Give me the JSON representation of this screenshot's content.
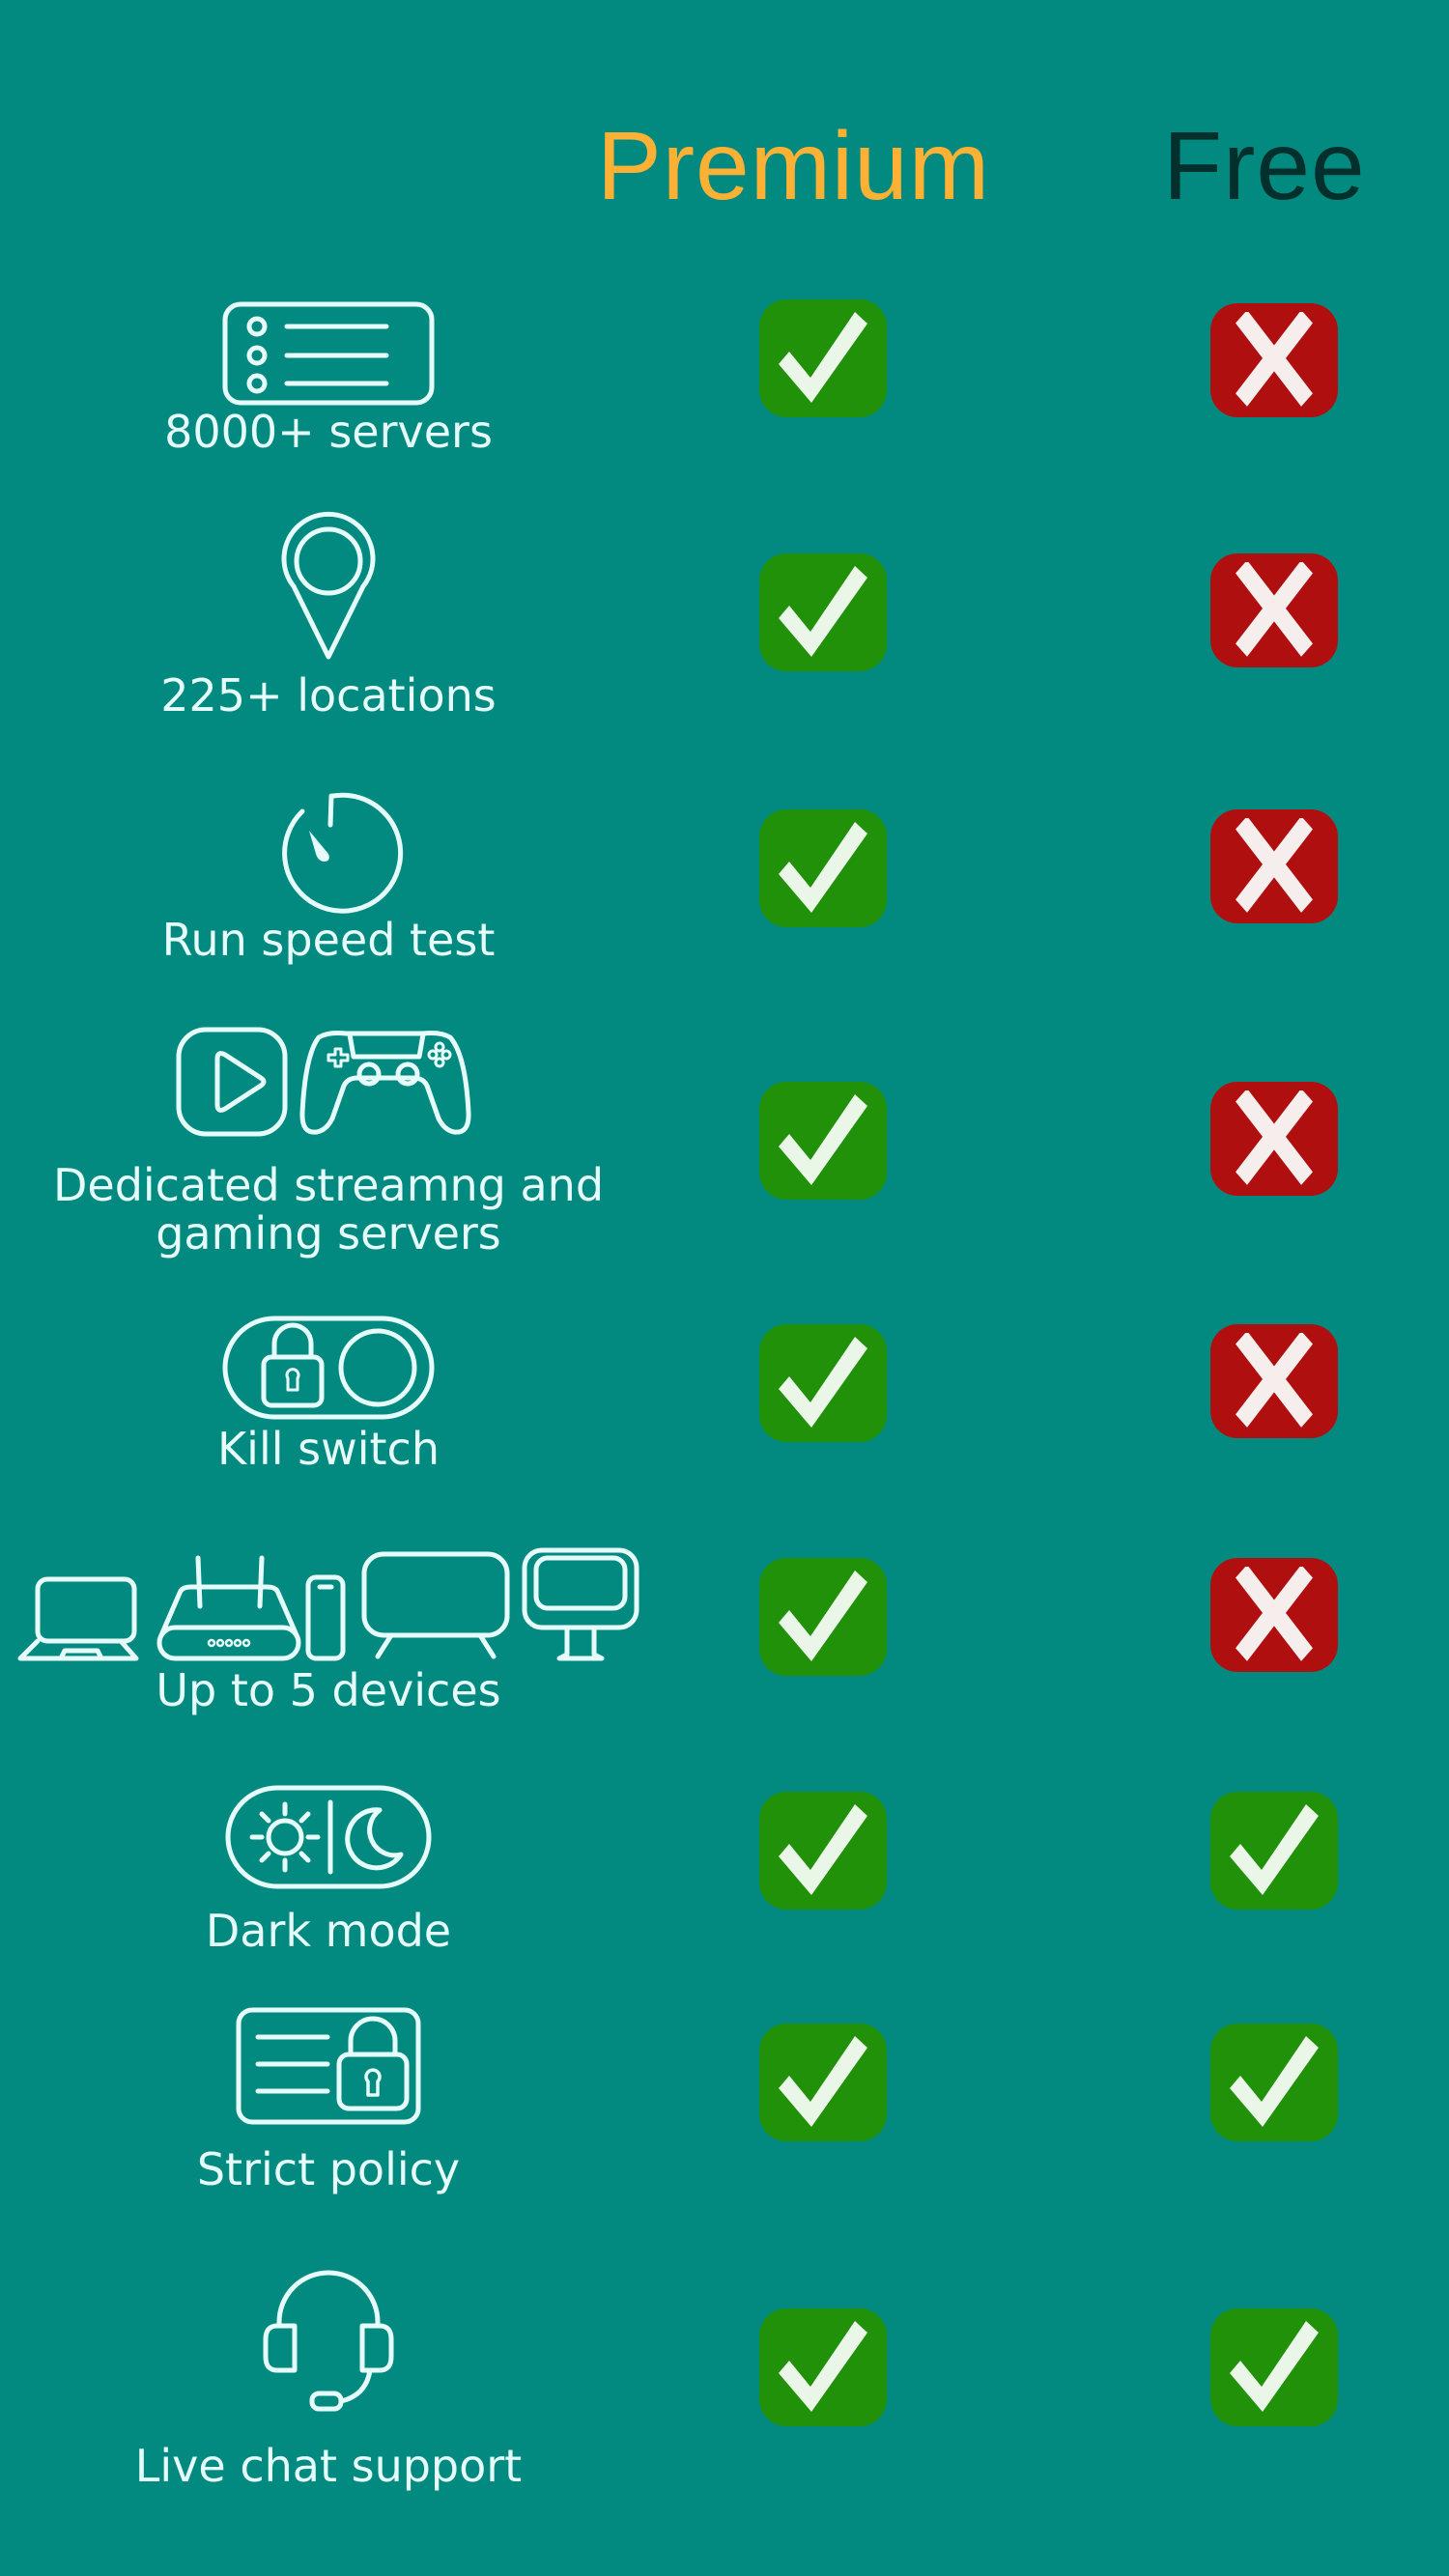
{
  "header": {
    "premium_label": "Premium",
    "free_label": "Free"
  },
  "colors": {
    "background": "#038a80",
    "premium_heading": "#fcb135",
    "free_heading": "#03302d",
    "yes_badge": "#21910a",
    "no_badge": "#b00f0f",
    "text": "#e6fcfa"
  },
  "features": [
    {
      "label": "8000+ servers",
      "icon": "server-list-icon",
      "premium": true,
      "free": false
    },
    {
      "label": "225+ locations",
      "icon": "location-pin-icon",
      "premium": true,
      "free": false
    },
    {
      "label": "Run speed test",
      "icon": "speedometer-icon",
      "premium": true,
      "free": false
    },
    {
      "label": "Dedicated streamng and\ngaming servers",
      "icon": "play-and-gamepad-icon",
      "premium": true,
      "free": false
    },
    {
      "label": "Kill switch",
      "icon": "lock-toggle-icon",
      "premium": true,
      "free": false
    },
    {
      "label": "Up to 5 devices",
      "icon": "devices-icon",
      "premium": true,
      "free": false
    },
    {
      "label": "Dark mode",
      "icon": "sun-moon-toggle-icon",
      "premium": true,
      "free": true
    },
    {
      "label": "Strict policy",
      "icon": "policy-lock-icon",
      "premium": true,
      "free": true
    },
    {
      "label": "Live chat support",
      "icon": "headset-icon",
      "premium": true,
      "free": true
    }
  ],
  "status_icons": {
    "yes": "check-icon",
    "no": "cross-icon"
  }
}
